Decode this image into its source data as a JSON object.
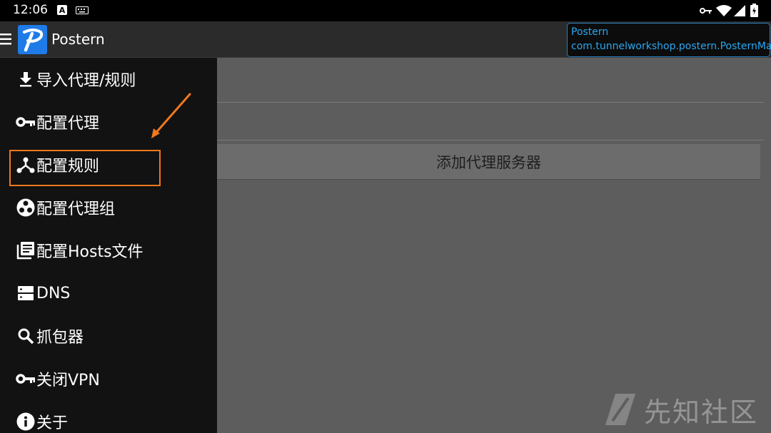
{
  "status_bar": {
    "time": "12:06",
    "icons": [
      "a-box-icon",
      "keyboard-icon",
      "vpn-key-icon",
      "wifi-icon",
      "signal-icon",
      "battery-charging-icon"
    ]
  },
  "app_bar": {
    "title": "Postern",
    "logo_letter": "P",
    "activity_tip": {
      "line1": "Postern",
      "line2": "com.tunnelworkshop.postern.PosternMain"
    }
  },
  "drawer": {
    "items": [
      {
        "label": "导入代理/规则",
        "icon": "download-icon"
      },
      {
        "label": "配置代理",
        "icon": "key-icon"
      },
      {
        "label": "配置规则",
        "icon": "branch-icon"
      },
      {
        "label": "配置代理组",
        "icon": "group-icon"
      },
      {
        "label": "配置Hosts文件",
        "icon": "library-icon"
      },
      {
        "label": "DNS",
        "icon": "server-icon"
      },
      {
        "label": "抓包器",
        "icon": "search-icon"
      },
      {
        "label": "关闭VPN",
        "icon": "key-icon"
      },
      {
        "label": "关于",
        "icon": "info-icon"
      }
    ]
  },
  "main": {
    "add_server_label": "添加代理服务器"
  },
  "watermark": {
    "text": "先知社区"
  },
  "colors": {
    "accent_blue": "#1e7be8",
    "highlight_orange": "#f0781f",
    "tip_text": "#2aa7f0"
  }
}
